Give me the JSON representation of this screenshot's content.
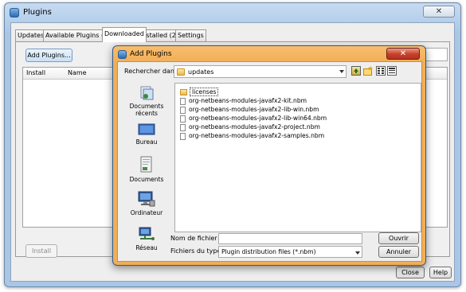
{
  "plugins_window": {
    "title": "Plugins",
    "close_glyph": "✕",
    "tabs": [
      {
        "label": "Updates",
        "active": false
      },
      {
        "label": "Available Plugins (72)",
        "active": false
      },
      {
        "label": "Downloaded",
        "active": true
      },
      {
        "label": "Installed (24)",
        "active": false
      },
      {
        "label": "Settings",
        "active": false
      }
    ],
    "add_plugins_label": "Add Plugins...",
    "search_value": "",
    "table_headers": {
      "install": "Install",
      "name": "Name"
    },
    "install_label": "Install",
    "close_label": "Close",
    "help_label": "Help"
  },
  "add_plugins_dialog": {
    "title": "Add Plugins",
    "close_glyph": "✕",
    "look_in_label": "Rechercher dans :",
    "look_in_value": "updates",
    "places": [
      {
        "label": "Documents récents",
        "icon": "recent-documents-icon"
      },
      {
        "label": "Bureau",
        "icon": "desktop-icon"
      },
      {
        "label": "Documents",
        "icon": "documents-icon"
      },
      {
        "label": "Ordinateur",
        "icon": "computer-icon"
      },
      {
        "label": "Réseau",
        "icon": "network-icon"
      }
    ],
    "files": [
      {
        "name": "licenses",
        "type": "folder"
      },
      {
        "name": "org-netbeans-modules-javafx2-kit.nbm",
        "type": "file"
      },
      {
        "name": "org-netbeans-modules-javafx2-lib-win.nbm",
        "type": "file"
      },
      {
        "name": "org-netbeans-modules-javafx2-lib-win64.nbm",
        "type": "file"
      },
      {
        "name": "org-netbeans-modules-javafx2-project.nbm",
        "type": "file"
      },
      {
        "name": "org-netbeans-modules-javafx2-samples.nbm",
        "type": "file"
      }
    ],
    "filename_label": "Nom de fichier :",
    "filename_value": "",
    "filetype_label": "Fichiers du type :",
    "filetype_value": "Plugin distribution files (*.nbm)",
    "open_label": "Ouvrir",
    "cancel_label": "Annuler"
  }
}
